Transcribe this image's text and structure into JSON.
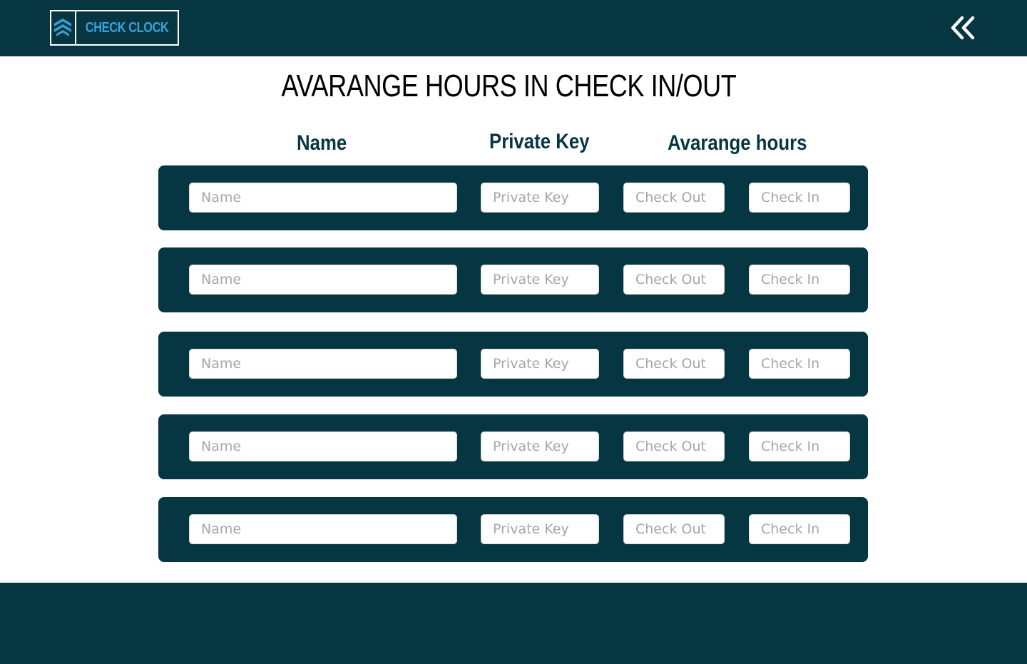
{
  "app": {
    "logo_text": "CHECK CLOCK",
    "logo_icon": "stacked-chevrons-up-icon",
    "collapse_icon": "double-chevron-left-icon"
  },
  "page": {
    "title": "AVARANGE HOURS IN CHECK IN/OUT"
  },
  "table": {
    "headers": {
      "name": "Name",
      "private_key": "Private Key",
      "avg_hours": "Avarange hours"
    },
    "rows": [
      {
        "name_placeholder": "Name",
        "key_placeholder": "Private Key",
        "checkout_placeholder": "Check Out",
        "checkin_placeholder": "Check In"
      },
      {
        "name_placeholder": "Name",
        "key_placeholder": "Private Key",
        "checkout_placeholder": "Check Out",
        "checkin_placeholder": "Check In"
      },
      {
        "name_placeholder": "Name",
        "key_placeholder": "Private Key",
        "checkout_placeholder": "Check Out",
        "checkin_placeholder": "Check In"
      },
      {
        "name_placeholder": "Name",
        "key_placeholder": "Private Key",
        "checkout_placeholder": "Check Out",
        "checkin_placeholder": "Check In"
      },
      {
        "name_placeholder": "Name",
        "key_placeholder": "Private Key",
        "checkout_placeholder": "Check Out",
        "checkin_placeholder": "Check In"
      }
    ]
  },
  "colors": {
    "primary": "#063642",
    "accent": "#3aa0d8",
    "background": "#ffffff"
  }
}
